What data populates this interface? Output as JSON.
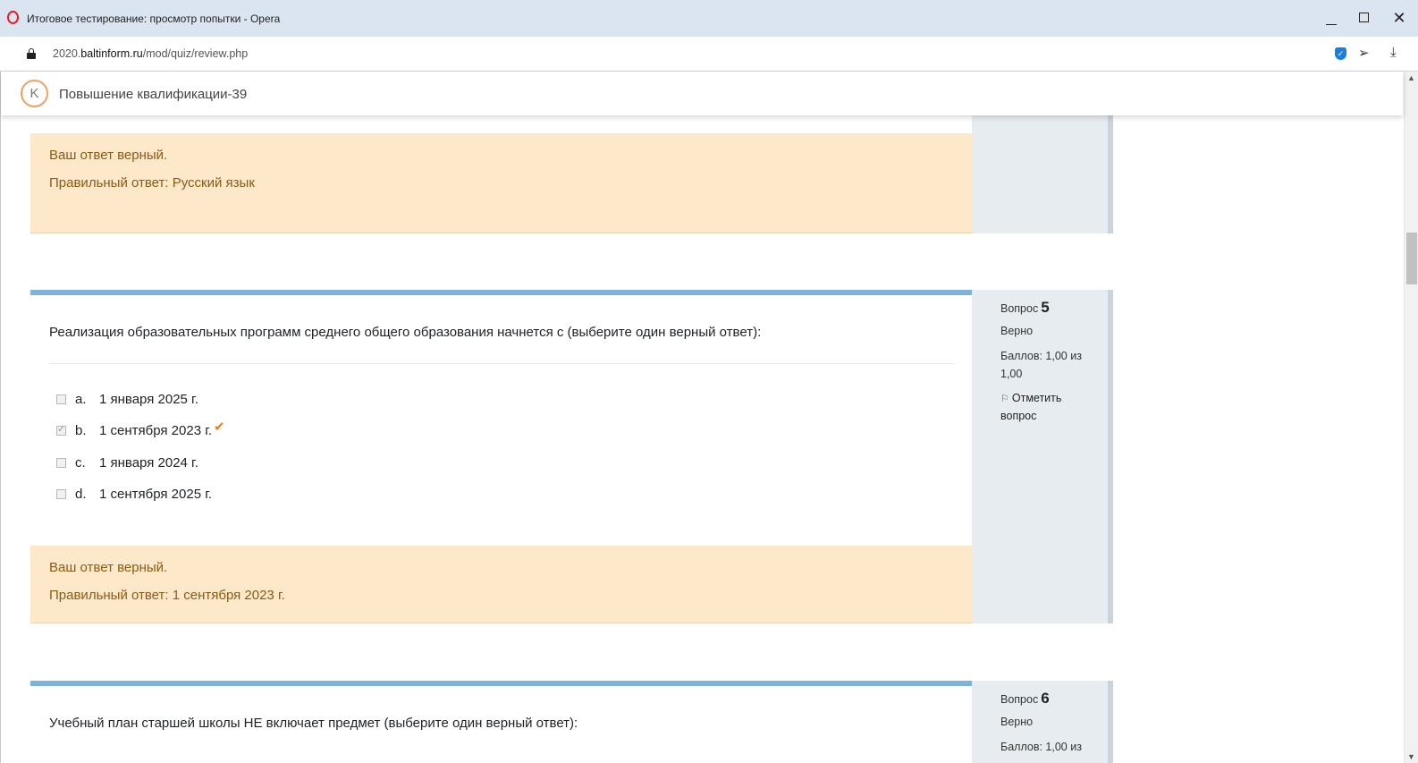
{
  "window": {
    "title": "Итоговое тестирование: просмотр попытки - Opera",
    "min_glyph": "",
    "close_glyph": "✕"
  },
  "address": {
    "url_prefix": "2020.",
    "url_host": "baltinform.ru",
    "url_path": "/mod/quiz/review.php"
  },
  "site": {
    "title": "Повышение квалификации-39",
    "logo_glyph": "K"
  },
  "questions": [
    {
      "feedback_correct": "Ваш ответ верный.",
      "feedback_answer": "Правильный ответ: Русский язык"
    },
    {
      "label": "Вопрос",
      "number": "5",
      "state": "Верно",
      "grade_line1": "Баллов: 1,00 из",
      "grade_line2": "1,00",
      "flag_line1": "Отметить",
      "flag_line2": "вопрос",
      "text": "Реализация образовательных программ среднего общего образования начнется с (выберите один верный ответ):",
      "answers": [
        {
          "letter": "a.",
          "text": "1 января 2025 г.",
          "checked": false
        },
        {
          "letter": "b.",
          "text": "1 сентября 2023 г.",
          "checked": true
        },
        {
          "letter": "c.",
          "text": "1 января 2024 г.",
          "checked": false
        },
        {
          "letter": "d.",
          "text": "1 сентября 2025 г.",
          "checked": false
        }
      ],
      "correct_mark": "✔",
      "feedback_correct": "Ваш ответ верный.",
      "feedback_answer": "Правильный ответ: 1 сентября 2023 г."
    },
    {
      "label": "Вопрос",
      "number": "6",
      "state": "Верно",
      "grade_line1": "Баллов: 1,00 из",
      "text": "Учебный план старшей школы НЕ включает предмет (выберите один верный ответ):"
    }
  ],
  "colors": {
    "feedback_bg": "#fde8c9",
    "feedback_text": "#8a5b14",
    "question_topbar": "#7fb2d8",
    "side_bg": "#e6ecf0",
    "correct_check": "#f07c1c"
  }
}
